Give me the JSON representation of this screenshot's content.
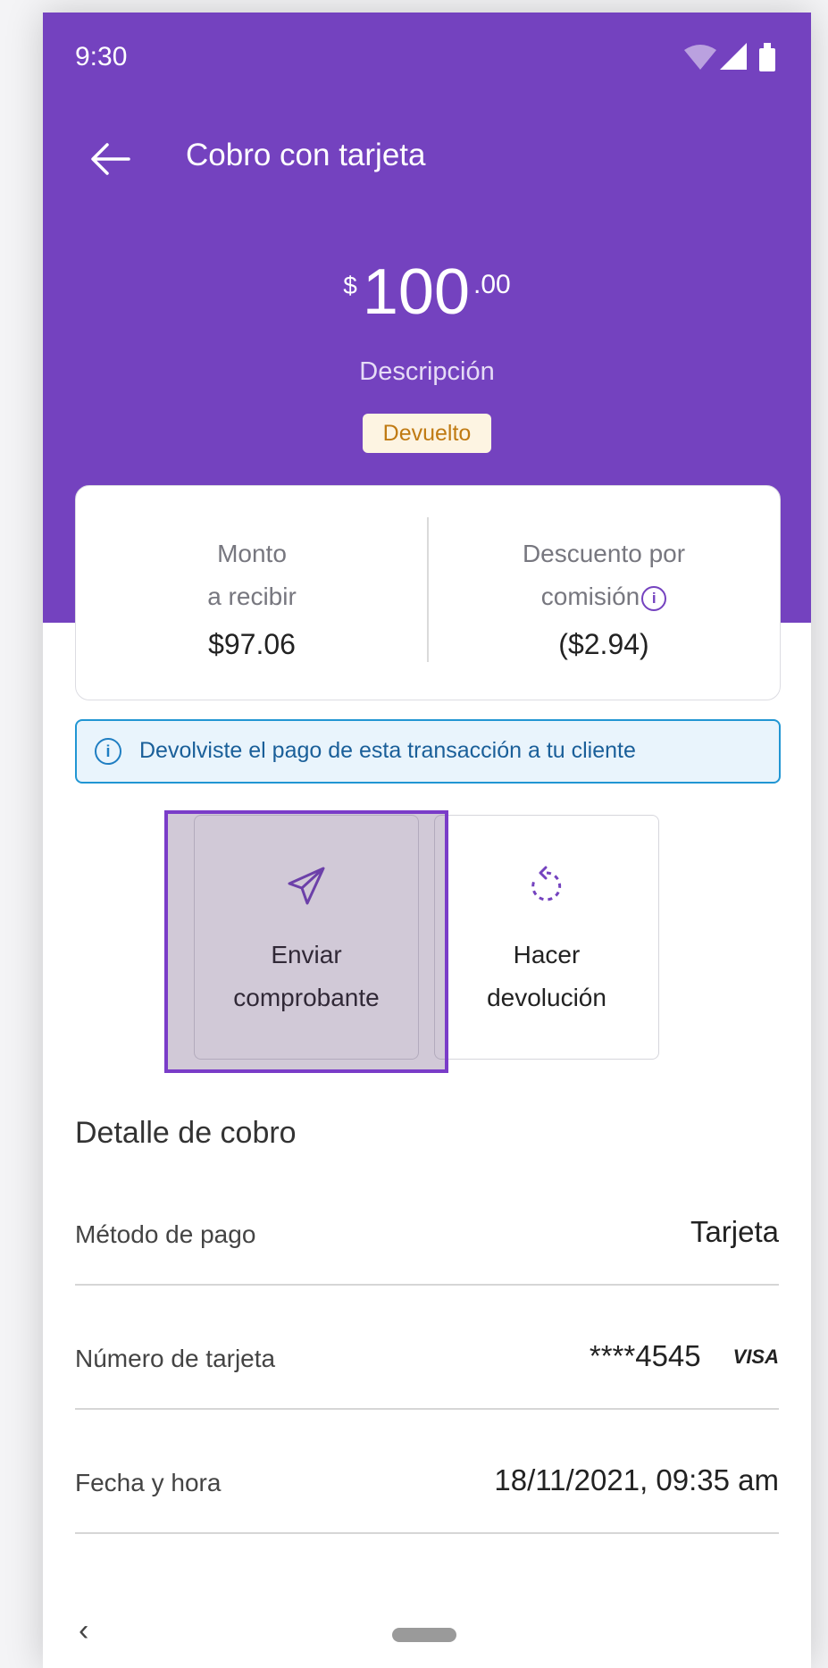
{
  "status_bar": {
    "time": "9:30"
  },
  "header": {
    "title": "Cobro con tarjeta"
  },
  "amount": {
    "currency": "$",
    "integer": "100",
    "decimals": ".00"
  },
  "description": "Descripción",
  "status_badge": "Devuelto",
  "summary": {
    "left_label_1": "Monto",
    "left_label_2": "a recibir",
    "left_value": "$97.06",
    "right_label_1": "Descuento por",
    "right_label_2": "comisión",
    "right_value": "($2.94)"
  },
  "alert": {
    "text": "Devolviste el pago de esta transacción a tu cliente"
  },
  "actions": {
    "send_line1": "Enviar",
    "send_line2": "comprobante",
    "refund_line1": "Hacer",
    "refund_line2": "devolución"
  },
  "details": {
    "title": "Detalle de cobro",
    "rows": [
      {
        "label": "Método de pago",
        "value": "Tarjeta"
      },
      {
        "label": "Número de tarjeta",
        "value": "****4545",
        "card_brand": "VISA"
      },
      {
        "label": "Fecha y hora",
        "value": "18/11/2021, 09:35 am"
      }
    ]
  },
  "colors": {
    "brand": "#7442bf",
    "badge_bg": "#fdf4e2",
    "badge_text": "#c07a12",
    "alert_border": "#2196d3"
  }
}
